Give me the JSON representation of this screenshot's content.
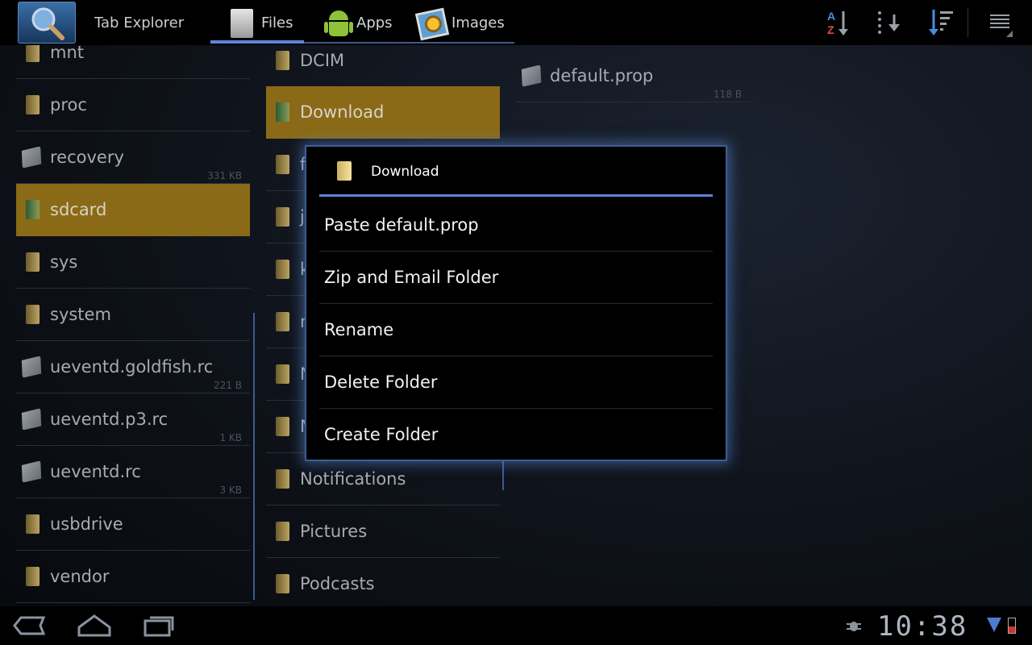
{
  "app": {
    "title": "Tab Explorer"
  },
  "tabs": [
    {
      "label": "Files",
      "icon": "documents-icon",
      "active": true
    },
    {
      "label": "Apps",
      "icon": "android-icon",
      "active": false
    },
    {
      "label": "Images",
      "icon": "images-icon",
      "active": false
    }
  ],
  "actions": [
    {
      "name": "sort-az-button",
      "icon": "sort-alphabetical-icon"
    },
    {
      "name": "sort-order-button",
      "icon": "sort-down-icon"
    },
    {
      "name": "sort-size-button",
      "icon": "sort-bars-icon"
    },
    {
      "name": "overflow-menu-button",
      "icon": "menu-icon"
    }
  ],
  "left_list": [
    {
      "name": "mnt",
      "type": "folder",
      "size": ""
    },
    {
      "name": "proc",
      "type": "folder",
      "size": ""
    },
    {
      "name": "recovery",
      "type": "file",
      "size": "331 KB"
    },
    {
      "name": "sdcard",
      "type": "folder-link",
      "size": "",
      "selected": true
    },
    {
      "name": "sys",
      "type": "folder",
      "size": ""
    },
    {
      "name": "system",
      "type": "folder",
      "size": ""
    },
    {
      "name": "ueventd.goldfish.rc",
      "type": "file",
      "size": "221 B"
    },
    {
      "name": "ueventd.p3.rc",
      "type": "file",
      "size": "1 KB"
    },
    {
      "name": "ueventd.rc",
      "type": "file",
      "size": "3 KB"
    },
    {
      "name": "usbdrive",
      "type": "folder",
      "size": ""
    },
    {
      "name": "vendor",
      "type": "folder",
      "size": ""
    }
  ],
  "mid_list": [
    {
      "name": "DCIM",
      "type": "folder"
    },
    {
      "name": "Download",
      "type": "folder-link",
      "selected": true
    },
    {
      "name": "f",
      "type": "folder"
    },
    {
      "name": "js",
      "type": "folder"
    },
    {
      "name": "k",
      "type": "folder"
    },
    {
      "name": "r",
      "type": "folder"
    },
    {
      "name": "M",
      "type": "folder"
    },
    {
      "name": "M",
      "type": "folder"
    },
    {
      "name": "Notifications",
      "type": "folder"
    },
    {
      "name": "Pictures",
      "type": "folder"
    },
    {
      "name": "Podcasts",
      "type": "folder"
    }
  ],
  "right_list": [
    {
      "name": "default.prop",
      "type": "file",
      "size": "118 B"
    }
  ],
  "dialog": {
    "title": "Download",
    "options": [
      "Paste default.prop",
      "Zip and Email Folder",
      "Rename",
      "Delete Folder",
      "Create Folder"
    ]
  },
  "status": {
    "time": "10:38"
  },
  "colors": {
    "selected_row": "#8a6a16",
    "accent": "#5b86dc"
  }
}
